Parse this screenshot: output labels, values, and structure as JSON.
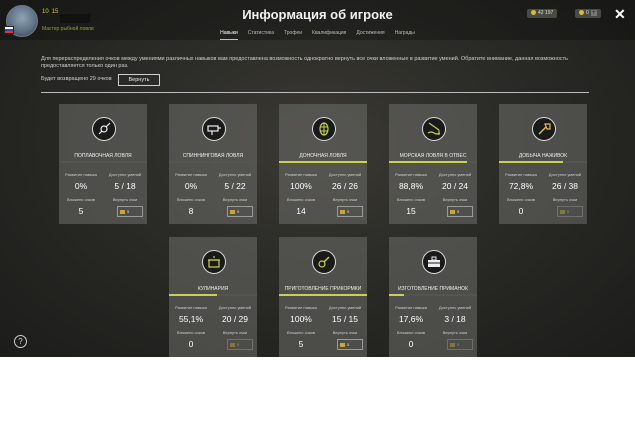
{
  "header": {
    "title": "Информация об игроке",
    "level": "10",
    "rank": "15",
    "player_title": "Мастер рыбной ловли",
    "currency": "42 197",
    "gold": "0"
  },
  "tabs": [
    {
      "label": "Навыки",
      "active": true
    },
    {
      "label": "Статистика",
      "active": false
    },
    {
      "label": "Трофеи",
      "active": false
    },
    {
      "label": "Квалификация",
      "active": false
    },
    {
      "label": "Достижения",
      "active": false
    },
    {
      "label": "Награды",
      "active": false
    }
  ],
  "info_text": "Для перераспределения очков между умениями различных навыков вам предоставлена возможность однократно вернуть все очки вложенные в развитие умений. Обратите внимание, данная возможность предоставляется только один раз.",
  "refund_text": "Будет возвращено 29 очков",
  "reset_label": "Вернуть",
  "labels": {
    "dev": "Развитие навыка",
    "avail": "Доступно умений",
    "invested": "Вложено очков",
    "refund": "Вернуть очки",
    "cost": "5"
  },
  "skills": [
    {
      "name": "ПОПЛАВОЧНАЯ ЛОВЛЯ",
      "progress": "0%",
      "avail": "5 / 18",
      "invested": "5",
      "fill": 0,
      "icon": "float-icon",
      "refund_enabled": true
    },
    {
      "name": "СПИННИНГОВАЯ ЛОВЛЯ",
      "progress": "0%",
      "avail": "5 / 22",
      "invested": "8",
      "fill": 0,
      "icon": "reel-icon",
      "refund_enabled": true
    },
    {
      "name": "ДОНОЧНАЯ ЛОВЛЯ",
      "progress": "100%",
      "avail": "26 / 26",
      "invested": "14",
      "fill": 100,
      "icon": "feeder-icon",
      "refund_enabled": true
    },
    {
      "name": "МОРСКАЯ ЛОВЛЯ В ОТВЕС",
      "progress": "88,8%",
      "avail": "20 / 24",
      "invested": "15",
      "fill": 88.8,
      "icon": "sea-icon",
      "refund_enabled": true
    },
    {
      "name": "ДОБЫЧА НАЖИВОК",
      "progress": "72,8%",
      "avail": "26 / 38",
      "invested": "0",
      "fill": 72.8,
      "icon": "shovel-icon",
      "refund_enabled": false
    },
    {
      "name": "КУЛИНАРИЯ",
      "progress": "55,1%",
      "avail": "20 / 29",
      "invested": "0",
      "fill": 55.1,
      "icon": "pot-icon",
      "refund_enabled": false
    },
    {
      "name": "ПРИГОТОВЛЕНИЕ ПРИКОРМКИ",
      "progress": "100%",
      "avail": "15 / 15",
      "invested": "5",
      "fill": 100,
      "icon": "groundbait-icon",
      "refund_enabled": true
    },
    {
      "name": "ИЗГОТОВЛЕНИЕ ПРИМАНОК",
      "progress": "17,6%",
      "avail": "3 / 18",
      "invested": "0",
      "fill": 17.6,
      "icon": "tackle-box-icon",
      "refund_enabled": false
    }
  ],
  "help_label": "?"
}
